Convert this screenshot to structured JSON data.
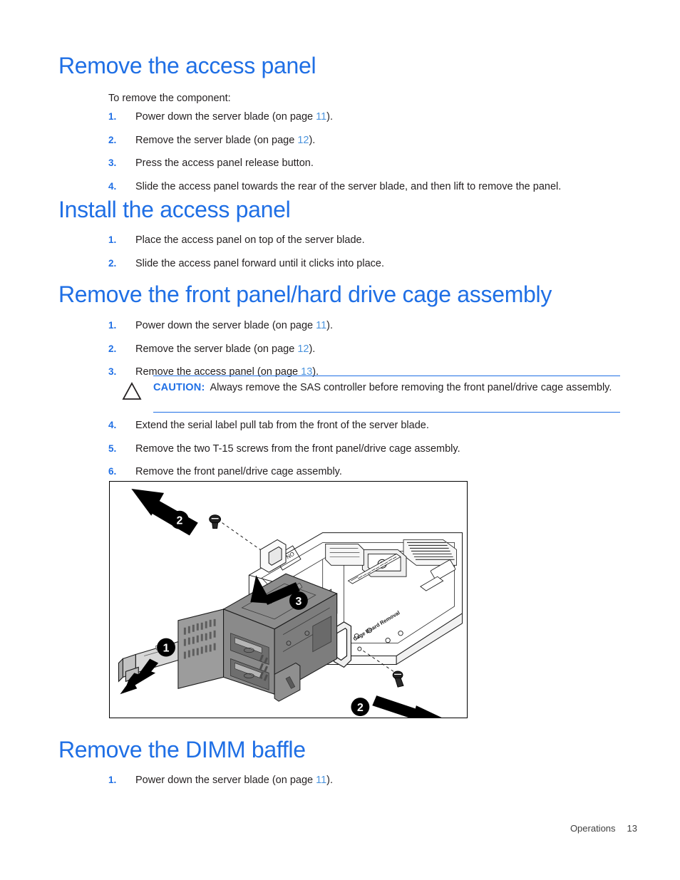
{
  "colors": {
    "heading_blue": "#1f6fe5",
    "link_blue": "#4d95de",
    "body_black": "#231f20",
    "rule_blue": "#1f6fe5"
  },
  "sections": [
    {
      "heading": "Remove the access panel",
      "intro": "To remove the component:",
      "steps": [
        {
          "num": "1.",
          "text_before": "Power down the server blade (on page ",
          "pageref": "11",
          "text_after": ")."
        },
        {
          "num": "2.",
          "text_before": "Remove the server blade (on page ",
          "pageref": "12",
          "text_after": ")."
        },
        {
          "num": "3.",
          "text_before": "Press the access panel release button.",
          "pageref": "",
          "text_after": ""
        },
        {
          "num": "4.",
          "text_before": "Slide the access panel towards the rear of the server blade, and then lift to remove the panel.",
          "pageref": "",
          "text_after": ""
        }
      ]
    },
    {
      "heading": "Install the access panel",
      "intro": "",
      "steps": [
        {
          "num": "1.",
          "text_before": "Place the access panel on top of the server blade.",
          "pageref": "",
          "text_after": ""
        },
        {
          "num": "2.",
          "text_before": "Slide the access panel forward until it clicks into place.",
          "pageref": "",
          "text_after": ""
        }
      ]
    },
    {
      "heading": "Remove the front panel/hard drive cage assembly",
      "intro": "",
      "steps": [
        {
          "num": "1.",
          "text_before": "Power down the server blade (on page ",
          "pageref": "11",
          "text_after": ")."
        },
        {
          "num": "2.",
          "text_before": "Remove the server blade (on page ",
          "pageref": "12",
          "text_after": ")."
        },
        {
          "num": "3.",
          "text_before": "Remove the access panel (on page ",
          "pageref": "13",
          "text_after": ")."
        }
      ],
      "steps_after_caution": [
        {
          "num": "4.",
          "text_before": "Extend the serial label pull tab from the front of the server blade.",
          "pageref": "",
          "text_after": ""
        },
        {
          "num": "5.",
          "text_before": "Remove the two T-15 screws from the front panel/drive cage assembly.",
          "pageref": "",
          "text_after": ""
        },
        {
          "num": "6.",
          "text_before": "Remove the front panel/drive cage assembly.",
          "pageref": "",
          "text_after": ""
        }
      ]
    },
    {
      "heading": "Remove the DIMM baffle",
      "intro": "",
      "steps": [
        {
          "num": "1.",
          "text_before": "Power down the server blade (on page ",
          "pageref": "11",
          "text_after": ")."
        }
      ]
    }
  ],
  "caution": {
    "icon": "warning-triangle-icon",
    "label": "CAUTION:",
    "text": "Always remove the SAS controller before removing the front panel/drive cage assembly."
  },
  "figure": {
    "name": "front-panel-drive-cage-removal-illustration",
    "callouts": [
      "1",
      "2",
      "2",
      "3"
    ],
    "board_label": "Cage Board Removal"
  },
  "footer": {
    "chapter": "Operations",
    "page_number": "13"
  }
}
